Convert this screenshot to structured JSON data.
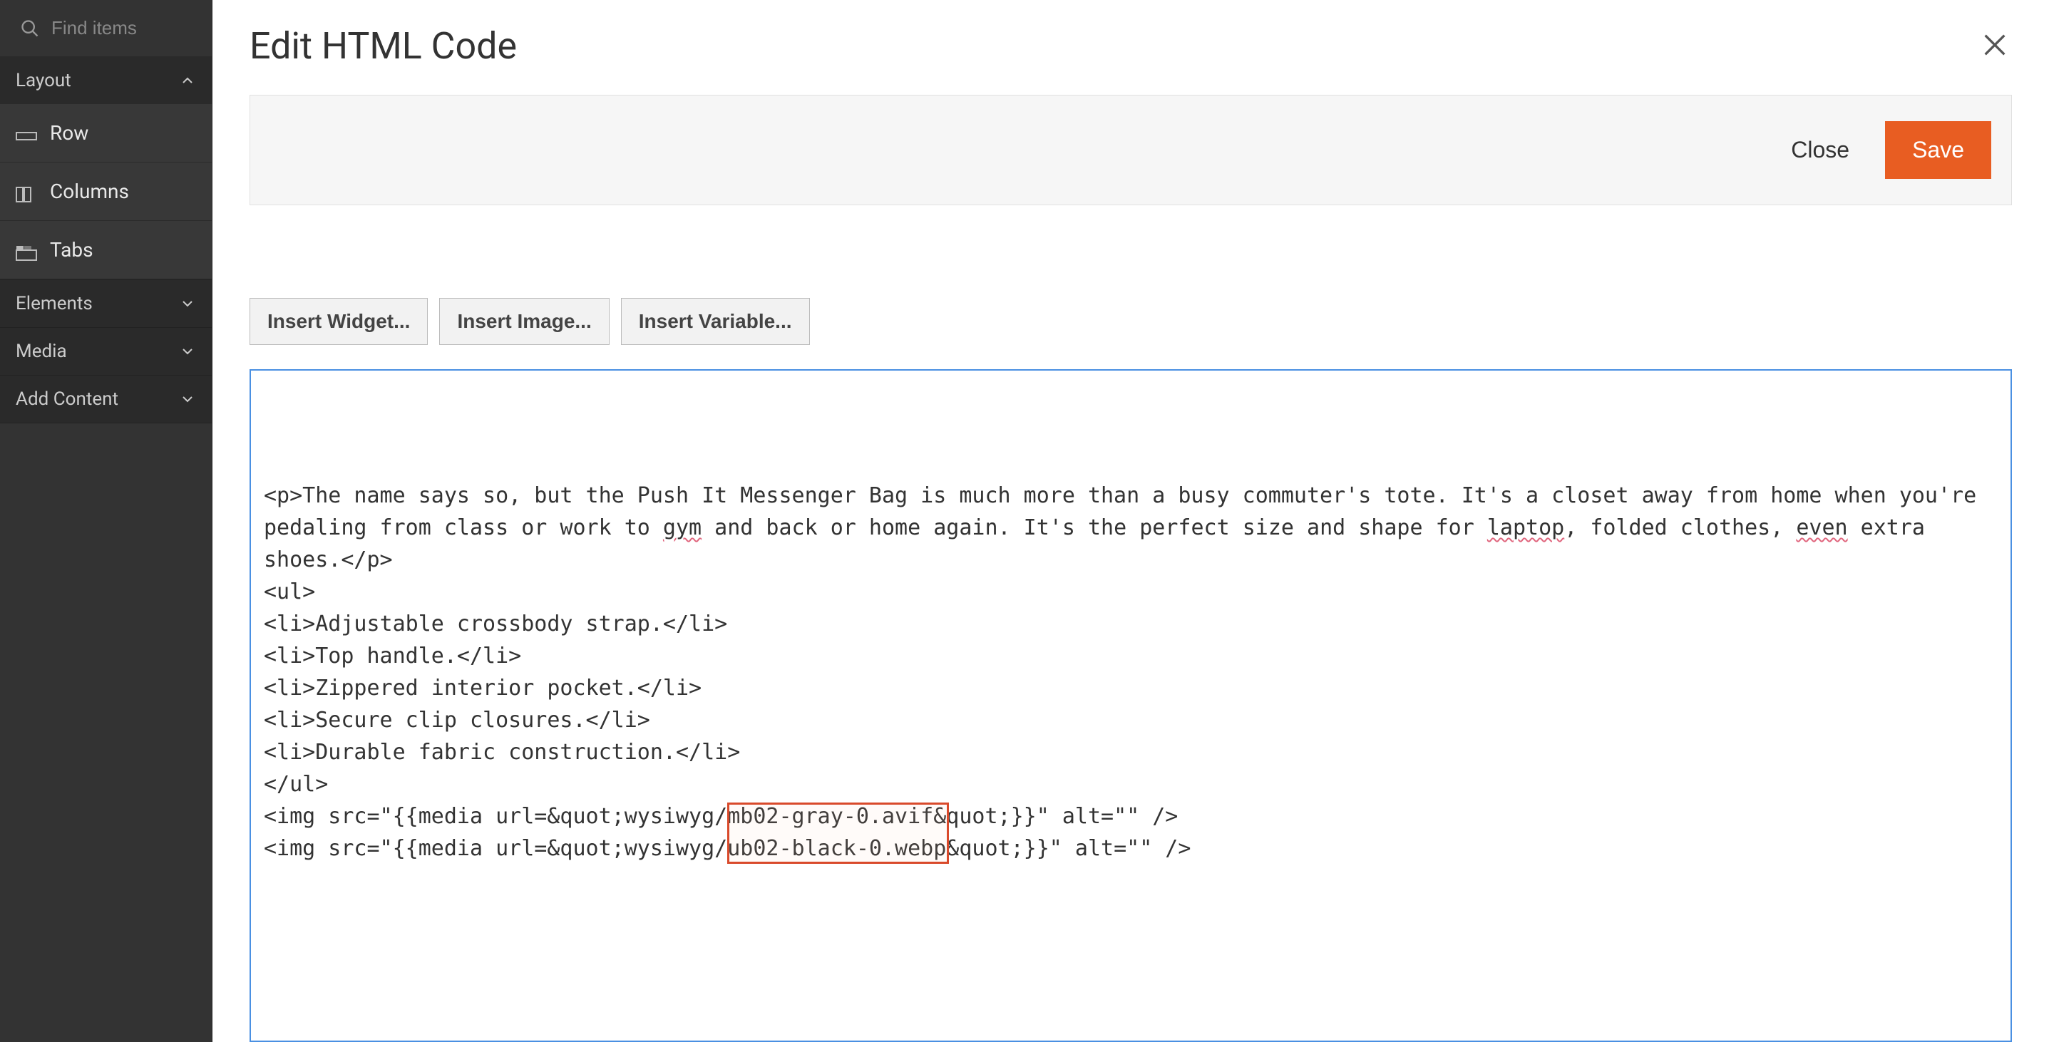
{
  "sidebar": {
    "search_placeholder": "Find items",
    "sections": {
      "layout": {
        "label": "Layout",
        "expanded": true,
        "items": [
          {
            "label": "Row",
            "icon": "row-icon"
          },
          {
            "label": "Columns",
            "icon": "columns-icon"
          },
          {
            "label": "Tabs",
            "icon": "tabs-icon"
          }
        ]
      },
      "elements": {
        "label": "Elements",
        "expanded": false
      },
      "media": {
        "label": "Media",
        "expanded": false
      },
      "add_content": {
        "label": "Add Content",
        "expanded": false
      }
    }
  },
  "header": {
    "title": "Edit HTML Code"
  },
  "actions": {
    "close": "Close",
    "save": "Save"
  },
  "toolbar": {
    "insert_widget": "Insert Widget...",
    "insert_image": "Insert Image...",
    "insert_variable": "Insert Variable..."
  },
  "editor": {
    "spellcheck_words": [
      "gym",
      "laptop",
      "even"
    ],
    "lines": [
      "<p>The name says so, but the Push It Messenger Bag is much more than a busy commuter's tote. It's a closet away from home when you're pedaling from class or work to gym and back or home again. It's the perfect size and shape for laptop, folded clothes, even extra shoes.</p>",
      "<ul>",
      "<li>Adjustable crossbody strap.</li>",
      "<li>Top handle.</li>",
      "<li>Zippered interior pocket.</li>",
      "<li>Secure clip closures.</li>",
      "<li>Durable fabric construction.</li>",
      "</ul>",
      "<img src=\"{{media url=&quot;wysiwyg/mb02-gray-0.avif&quot;}}\" alt=\"\" />",
      "<img src=\"{{media url=&quot;wysiwyg/ub02-black-0.webp&quot;}}\" alt=\"\" />"
    ],
    "highlight": {
      "text_samples": [
        "mb02-gray-0.avif&",
        "ub02-black-0.webp"
      ]
    }
  }
}
